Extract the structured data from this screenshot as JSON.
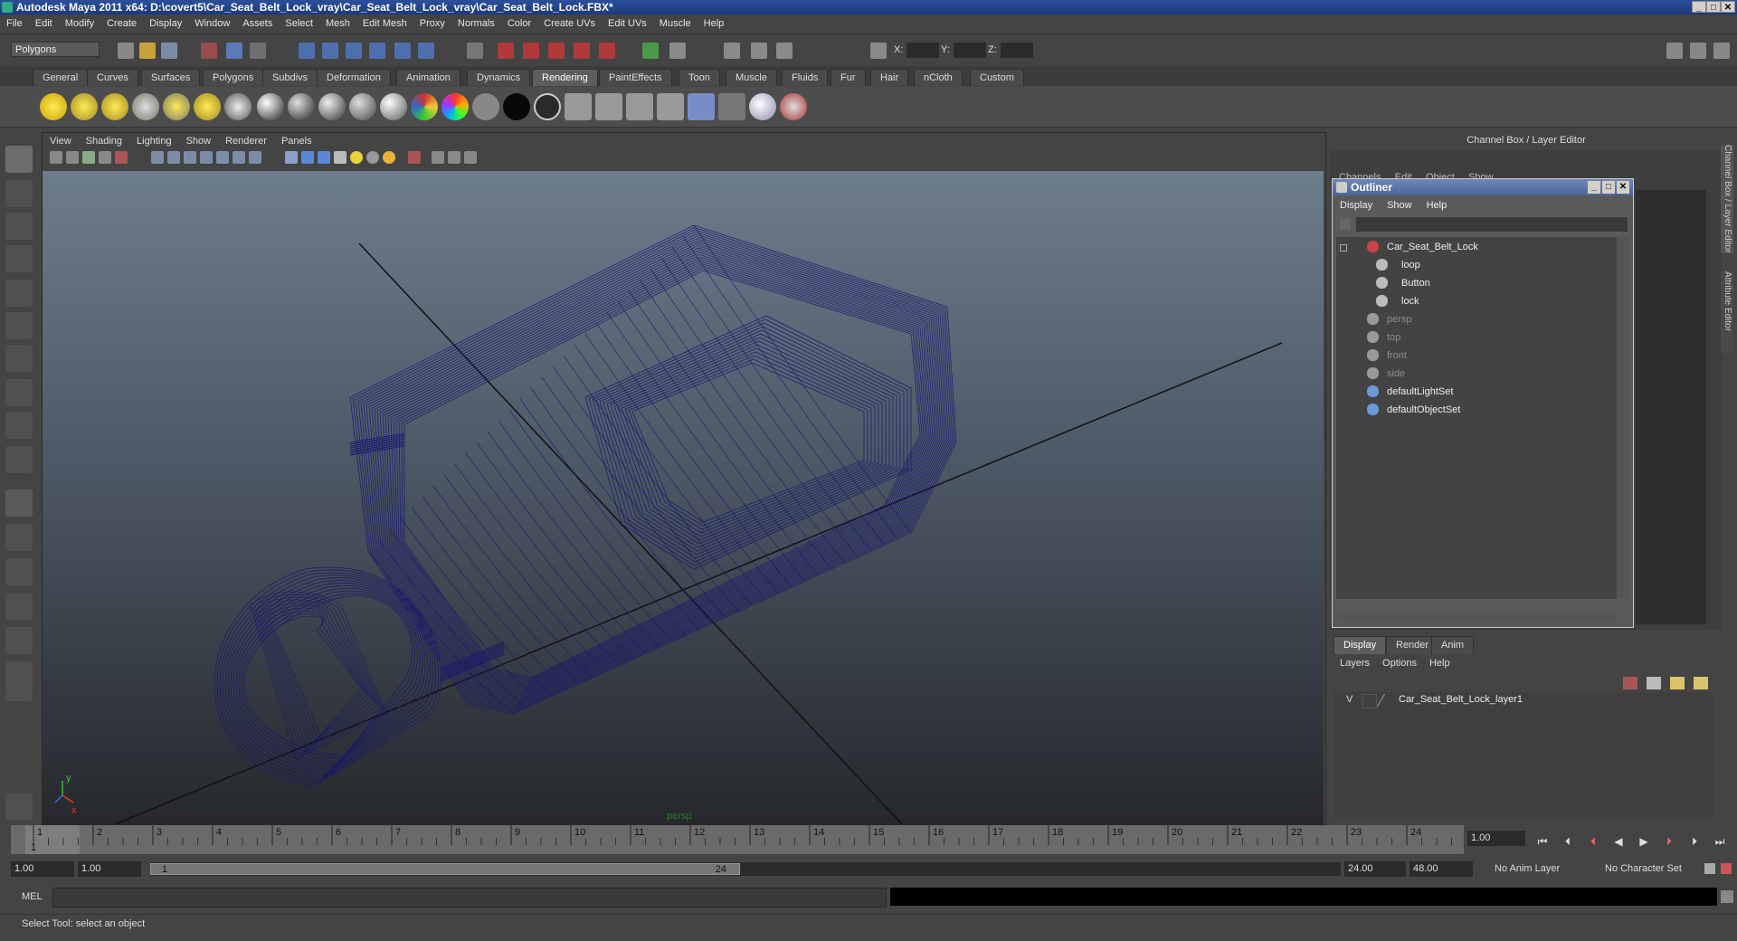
{
  "title": "Autodesk Maya 2011 x64: D:\\covert5\\Car_Seat_Belt_Lock_vray\\Car_Seat_Belt_Lock_vray\\Car_Seat_Belt_Lock.FBX*",
  "menu": [
    "File",
    "Edit",
    "Modify",
    "Create",
    "Display",
    "Window",
    "Assets",
    "Select",
    "Mesh",
    "Edit Mesh",
    "Proxy",
    "Normals",
    "Color",
    "Create UVs",
    "Edit UVs",
    "Muscle",
    "Help"
  ],
  "status": {
    "mode_select": "Polygons",
    "x_label": "X:",
    "y_label": "Y:",
    "z_label": "Z:"
  },
  "shelf_tabs": [
    "General",
    "Curves",
    "Surfaces",
    "Polygons",
    "Subdivs",
    "Deformation",
    "Animation",
    "Dynamics",
    "Rendering",
    "PaintEffects",
    "Toon",
    "Muscle",
    "Fluids",
    "Fur",
    "Hair",
    "nCloth",
    "Custom"
  ],
  "active_shelf_tab": "Rendering",
  "viewport": {
    "menu": [
      "View",
      "Shading",
      "Lighting",
      "Show",
      "Renderer",
      "Panels"
    ],
    "camera_label": "persp",
    "axis_x": "x",
    "axis_y": "y",
    "wire_color": "#17186e"
  },
  "channel_box": {
    "header": "Channel Box / Layer Editor",
    "hidden_menu": [
      "Channels",
      "Edit",
      "Object",
      "Show"
    ]
  },
  "outliner": {
    "title": "Outliner",
    "menu": [
      "Display",
      "Show",
      "Help"
    ],
    "items": [
      {
        "label": "Car_Seat_Belt_Lock",
        "dim": false,
        "level": 0
      },
      {
        "label": "loop",
        "dim": false,
        "level": 1
      },
      {
        "label": "Button",
        "dim": false,
        "level": 1
      },
      {
        "label": "lock",
        "dim": false,
        "level": 1
      },
      {
        "label": "persp",
        "dim": true,
        "level": 0
      },
      {
        "label": "top",
        "dim": true,
        "level": 0
      },
      {
        "label": "front",
        "dim": true,
        "level": 0
      },
      {
        "label": "side",
        "dim": true,
        "level": 0
      },
      {
        "label": "defaultLightSet",
        "dim": false,
        "level": 0
      },
      {
        "label": "defaultObjectSet",
        "dim": false,
        "level": 0
      }
    ]
  },
  "layer_editor": {
    "tabs": [
      "Display",
      "Render",
      "Anim"
    ],
    "menu": [
      "Layers",
      "Options",
      "Help"
    ],
    "layer_visibility": "V",
    "layer_name": "Car_Seat_Belt_Lock_layer1"
  },
  "side_tabs": [
    "Channel Box / Layer Editor",
    "Attribute Editor"
  ],
  "time": {
    "ticks": [
      "1",
      "2",
      "3",
      "4",
      "5",
      "6",
      "7",
      "8",
      "9",
      "10",
      "11",
      "12",
      "13",
      "14",
      "15",
      "16",
      "17",
      "18",
      "19",
      "20",
      "21",
      "22",
      "23",
      "24"
    ],
    "current_frame_marker": "1",
    "current_time": "1.00",
    "range_start": "1.00",
    "playback_start": "1.00",
    "range_inner_start": "1",
    "range_inner_end": "24",
    "playback_end": "24.00",
    "range_end": "48.00",
    "anim_layer": "No Anim Layer",
    "character_set": "No Character Set"
  },
  "command_line": {
    "label": "MEL"
  },
  "help_line": "Select Tool: select an object"
}
